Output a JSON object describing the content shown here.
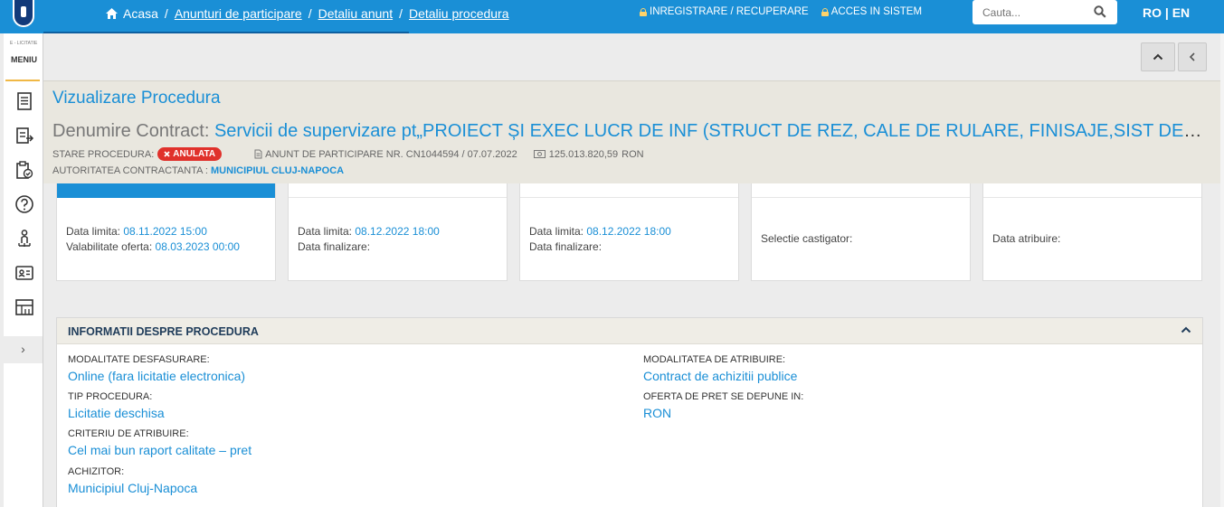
{
  "topbar": {
    "breadcrumb": {
      "home": "Acasa",
      "item1": "Anunturi de participare",
      "item2": "Detaliu anunt",
      "item3": "Detaliu procedura",
      "sep": "/"
    },
    "register": "INREGISTRARE / RECUPERARE",
    "login": "ACCES IN SISTEM",
    "search_placeholder": "Cauta...",
    "lang": "RO | EN"
  },
  "sidebar": {
    "brand_small": "E - LICITATIE",
    "menu_label": "MENIU",
    "toggle": "›",
    "icons": [
      "document-list-icon",
      "document-export-icon",
      "clipboard-check-icon",
      "help-icon",
      "person-hierarchy-icon",
      "id-card-icon",
      "catalog-icon"
    ]
  },
  "header": {
    "title": "Vizualizare Procedura",
    "contract_label": "Denumire Contract:",
    "contract_value": "Servicii de supervizare pt„PROIECT ȘI EXEC LUCR DE INF (STRUCT DE REZ, CALE DE RULARE, FINISAJE,SIST DE INSTAL), AUTOBAZĂ",
    "status_label": "STARE PROCEDURA:",
    "status_badge": "ANULATA",
    "notice": "ANUNT DE PARTICIPARE NR. CN1044594 / 07.07.2022",
    "value": "125.013.820,59",
    "currency": "RON",
    "authority_label": "AUTORITATEA CONTRACTANTA :",
    "authority_value": "MUNICIPIUL CLUJ-NAPOCA",
    "colors": {
      "accent": "#1a8fd6",
      "status": "#e0312b",
      "header_bg": "#e9e7df"
    }
  },
  "stages": [
    {
      "l1_label": "Data limita:",
      "l1_value": "08.11.2022 15:00",
      "l2_label": "Valabilitate oferta:",
      "l2_value": "08.03.2023 00:00"
    },
    {
      "l1_label": "Data limita:",
      "l1_value": "08.12.2022 18:00",
      "l2_label": "Data finalizare:",
      "l2_value": ""
    },
    {
      "l1_label": "Data limita:",
      "l1_value": "08.12.2022 18:00",
      "l2_label": "Data finalizare:",
      "l2_value": ""
    },
    {
      "l1_label": "Selectie castigator:"
    },
    {
      "l1_label": "Data atribuire:"
    }
  ],
  "info": {
    "title": "INFORMATII DESPRE PROCEDURA",
    "fields": {
      "modalitate_label": "MODALITATE DESFASURARE:",
      "modalitate_value": "Online (fara licitatie electronica)",
      "tip_label": "TIP PROCEDURA:",
      "tip_value": "Licitatie deschisa",
      "criteriu_label": "CRITERIU DE ATRIBUIRE:",
      "criteriu_value": "Cel mai bun raport calitate – pret",
      "achizitor_label": "ACHIZITOR:",
      "achizitor_value": "Municipiul Cluj-Napoca",
      "atribuire_label": "MODALITATEA DE ATRIBUIRE:",
      "atribuire_value": "Contract de achizitii publice",
      "oferta_label": "OFERTA DE PRET SE DEPUNE IN:",
      "oferta_value": "RON"
    }
  }
}
